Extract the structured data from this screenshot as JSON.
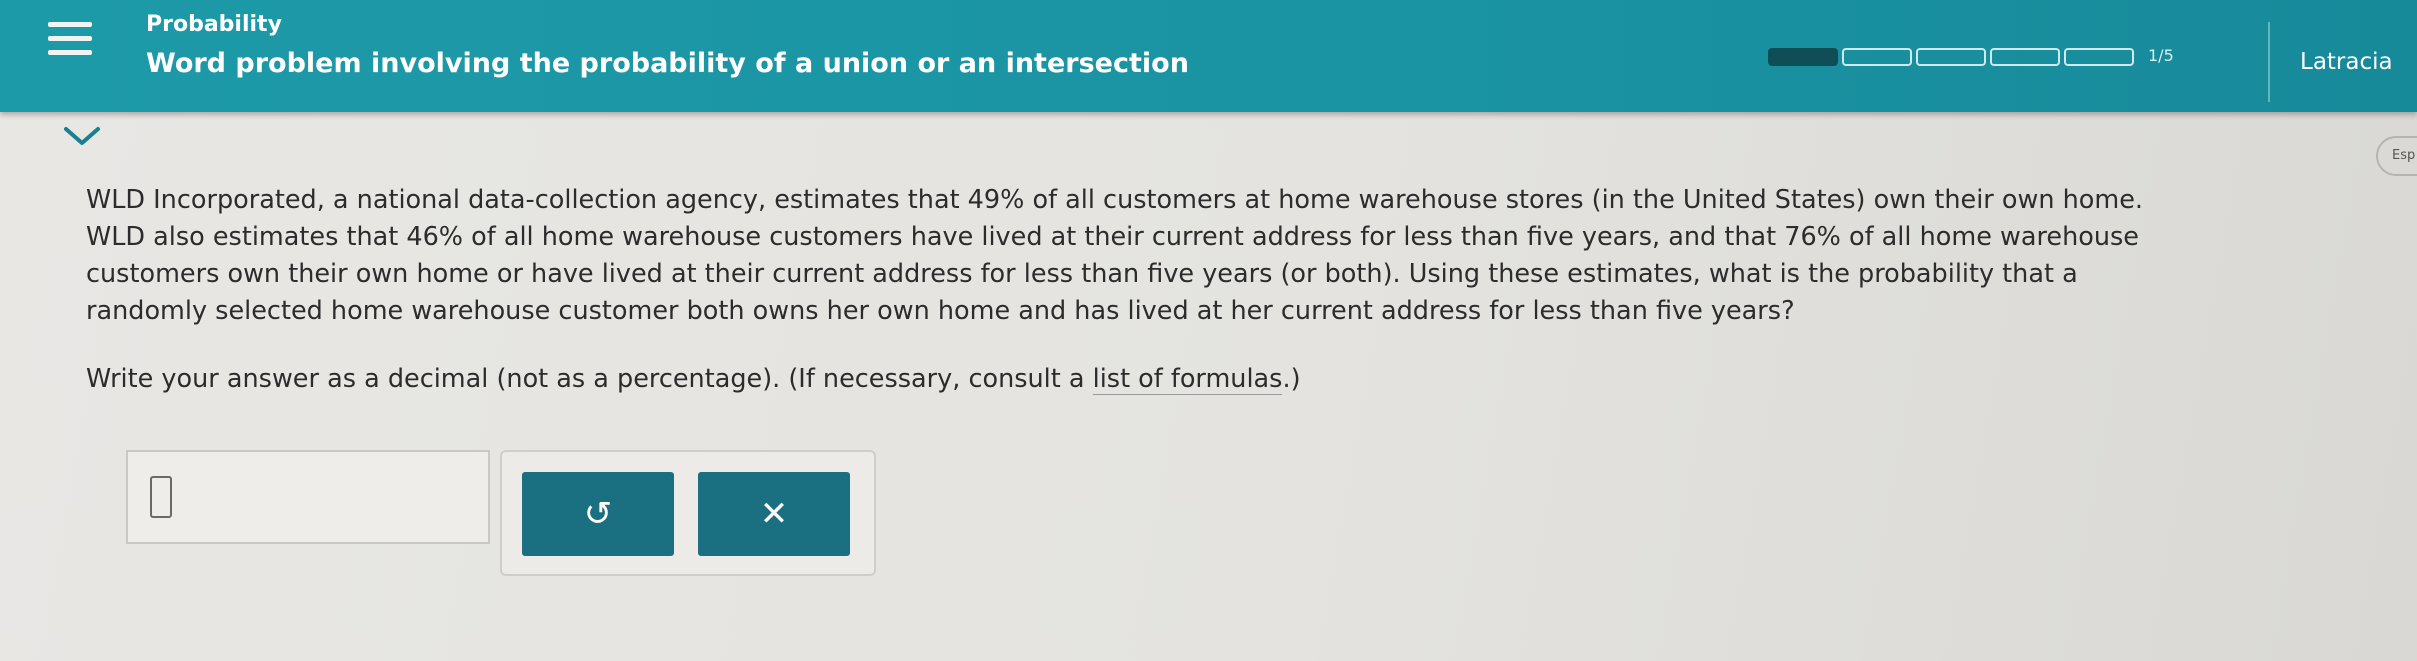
{
  "header": {
    "topic": "Probability",
    "title": "Word problem involving the probability of a union or an intersection",
    "progress": {
      "current": 1,
      "total": 5,
      "label": "1/5",
      "segments": 5,
      "filled_segments": 1
    },
    "user_name": "Latracia"
  },
  "side_tab": {
    "label": "Esp"
  },
  "problem": {
    "line1": "WLD Incorporated, a national data-collection agency, estimates that 49% of all customers at home warehouse stores (in the United States) own their own home.",
    "line2": "WLD also estimates that 46% of all home warehouse customers have lived at their current address for less than five years, and that 76% of all home warehouse",
    "line3": "customers own their own home or have lived at their current address for less than five years (or both). Using these estimates, what is the probability that a",
    "line4": "randomly selected home warehouse customer both owns her own home and has lived at her current address for less than five years?"
  },
  "instruction": {
    "before": "Write your answer as a decimal (not as a percentage). (If necessary, consult a ",
    "link": "list of formulas",
    "after": ".)"
  },
  "answer": {
    "value": ""
  },
  "buttons": {
    "undo_glyph": "↺",
    "clear_glyph": "✕"
  },
  "colors": {
    "header_bg": "#1d9aa8",
    "button_bg": "#1a6f80",
    "progress_fill": "#0f4d57"
  }
}
